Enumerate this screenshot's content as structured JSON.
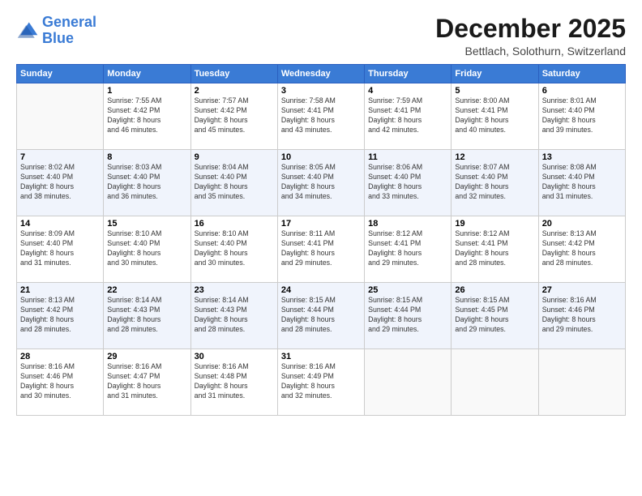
{
  "logo": {
    "line1": "General",
    "line2": "Blue"
  },
  "title": "December 2025",
  "location": "Bettlach, Solothurn, Switzerland",
  "weekdays": [
    "Sunday",
    "Monday",
    "Tuesday",
    "Wednesday",
    "Thursday",
    "Friday",
    "Saturday"
  ],
  "weeks": [
    [
      {
        "day": "",
        "info": ""
      },
      {
        "day": "1",
        "info": "Sunrise: 7:55 AM\nSunset: 4:42 PM\nDaylight: 8 hours\nand 46 minutes."
      },
      {
        "day": "2",
        "info": "Sunrise: 7:57 AM\nSunset: 4:42 PM\nDaylight: 8 hours\nand 45 minutes."
      },
      {
        "day": "3",
        "info": "Sunrise: 7:58 AM\nSunset: 4:41 PM\nDaylight: 8 hours\nand 43 minutes."
      },
      {
        "day": "4",
        "info": "Sunrise: 7:59 AM\nSunset: 4:41 PM\nDaylight: 8 hours\nand 42 minutes."
      },
      {
        "day": "5",
        "info": "Sunrise: 8:00 AM\nSunset: 4:41 PM\nDaylight: 8 hours\nand 40 minutes."
      },
      {
        "day": "6",
        "info": "Sunrise: 8:01 AM\nSunset: 4:40 PM\nDaylight: 8 hours\nand 39 minutes."
      }
    ],
    [
      {
        "day": "7",
        "info": "Sunrise: 8:02 AM\nSunset: 4:40 PM\nDaylight: 8 hours\nand 38 minutes."
      },
      {
        "day": "8",
        "info": "Sunrise: 8:03 AM\nSunset: 4:40 PM\nDaylight: 8 hours\nand 36 minutes."
      },
      {
        "day": "9",
        "info": "Sunrise: 8:04 AM\nSunset: 4:40 PM\nDaylight: 8 hours\nand 35 minutes."
      },
      {
        "day": "10",
        "info": "Sunrise: 8:05 AM\nSunset: 4:40 PM\nDaylight: 8 hours\nand 34 minutes."
      },
      {
        "day": "11",
        "info": "Sunrise: 8:06 AM\nSunset: 4:40 PM\nDaylight: 8 hours\nand 33 minutes."
      },
      {
        "day": "12",
        "info": "Sunrise: 8:07 AM\nSunset: 4:40 PM\nDaylight: 8 hours\nand 32 minutes."
      },
      {
        "day": "13",
        "info": "Sunrise: 8:08 AM\nSunset: 4:40 PM\nDaylight: 8 hours\nand 31 minutes."
      }
    ],
    [
      {
        "day": "14",
        "info": "Sunrise: 8:09 AM\nSunset: 4:40 PM\nDaylight: 8 hours\nand 31 minutes."
      },
      {
        "day": "15",
        "info": "Sunrise: 8:10 AM\nSunset: 4:40 PM\nDaylight: 8 hours\nand 30 minutes."
      },
      {
        "day": "16",
        "info": "Sunrise: 8:10 AM\nSunset: 4:40 PM\nDaylight: 8 hours\nand 30 minutes."
      },
      {
        "day": "17",
        "info": "Sunrise: 8:11 AM\nSunset: 4:41 PM\nDaylight: 8 hours\nand 29 minutes."
      },
      {
        "day": "18",
        "info": "Sunrise: 8:12 AM\nSunset: 4:41 PM\nDaylight: 8 hours\nand 29 minutes."
      },
      {
        "day": "19",
        "info": "Sunrise: 8:12 AM\nSunset: 4:41 PM\nDaylight: 8 hours\nand 28 minutes."
      },
      {
        "day": "20",
        "info": "Sunrise: 8:13 AM\nSunset: 4:42 PM\nDaylight: 8 hours\nand 28 minutes."
      }
    ],
    [
      {
        "day": "21",
        "info": "Sunrise: 8:13 AM\nSunset: 4:42 PM\nDaylight: 8 hours\nand 28 minutes."
      },
      {
        "day": "22",
        "info": "Sunrise: 8:14 AM\nSunset: 4:43 PM\nDaylight: 8 hours\nand 28 minutes."
      },
      {
        "day": "23",
        "info": "Sunrise: 8:14 AM\nSunset: 4:43 PM\nDaylight: 8 hours\nand 28 minutes."
      },
      {
        "day": "24",
        "info": "Sunrise: 8:15 AM\nSunset: 4:44 PM\nDaylight: 8 hours\nand 28 minutes."
      },
      {
        "day": "25",
        "info": "Sunrise: 8:15 AM\nSunset: 4:44 PM\nDaylight: 8 hours\nand 29 minutes."
      },
      {
        "day": "26",
        "info": "Sunrise: 8:15 AM\nSunset: 4:45 PM\nDaylight: 8 hours\nand 29 minutes."
      },
      {
        "day": "27",
        "info": "Sunrise: 8:16 AM\nSunset: 4:46 PM\nDaylight: 8 hours\nand 29 minutes."
      }
    ],
    [
      {
        "day": "28",
        "info": "Sunrise: 8:16 AM\nSunset: 4:46 PM\nDaylight: 8 hours\nand 30 minutes."
      },
      {
        "day": "29",
        "info": "Sunrise: 8:16 AM\nSunset: 4:47 PM\nDaylight: 8 hours\nand 31 minutes."
      },
      {
        "day": "30",
        "info": "Sunrise: 8:16 AM\nSunset: 4:48 PM\nDaylight: 8 hours\nand 31 minutes."
      },
      {
        "day": "31",
        "info": "Sunrise: 8:16 AM\nSunset: 4:49 PM\nDaylight: 8 hours\nand 32 minutes."
      },
      {
        "day": "",
        "info": ""
      },
      {
        "day": "",
        "info": ""
      },
      {
        "day": "",
        "info": ""
      }
    ]
  ]
}
